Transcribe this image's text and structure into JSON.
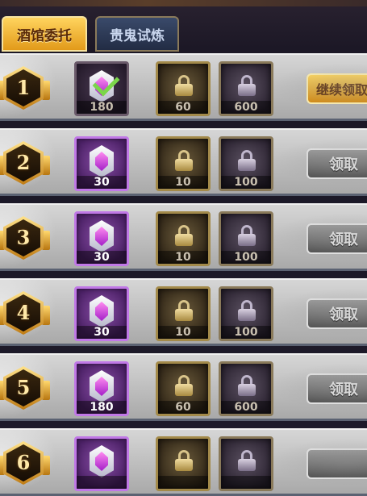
{
  "tabs": [
    {
      "label": "酒馆委托",
      "active": true
    },
    {
      "label": "贵鬼试炼",
      "active": false
    }
  ],
  "rows": [
    {
      "rank": "1",
      "reward1": "180",
      "reward1_claimed": true,
      "reward2": "60",
      "reward3": "600",
      "button": "继续领取",
      "button_style": "gold"
    },
    {
      "rank": "2",
      "reward1": "30",
      "reward1_claimed": false,
      "reward2": "10",
      "reward3": "100",
      "button": "领取",
      "button_style": "gray"
    },
    {
      "rank": "3",
      "reward1": "30",
      "reward1_claimed": false,
      "reward2": "10",
      "reward3": "100",
      "button": "领取",
      "button_style": "gray"
    },
    {
      "rank": "4",
      "reward1": "30",
      "reward1_claimed": false,
      "reward2": "10",
      "reward3": "100",
      "button": "领取",
      "button_style": "gray"
    },
    {
      "rank": "5",
      "reward1": "180",
      "reward1_claimed": false,
      "reward2": "60",
      "reward3": "600",
      "button": "领取",
      "button_style": "gray"
    },
    {
      "rank": "6",
      "reward1": "",
      "reward1_claimed": false,
      "reward2": "",
      "reward3": "",
      "button": "",
      "button_style": "gray"
    }
  ],
  "colors": {
    "accent_gold": "#ffd45e",
    "purple_frame": "#c078e6",
    "row_bg": "#c8c8c8"
  },
  "icons": {
    "rank": "hexagon-badge-icon",
    "gem": "purple-gem-icon",
    "lock": "padlock-icon",
    "claimed": "checkmark-icon"
  }
}
